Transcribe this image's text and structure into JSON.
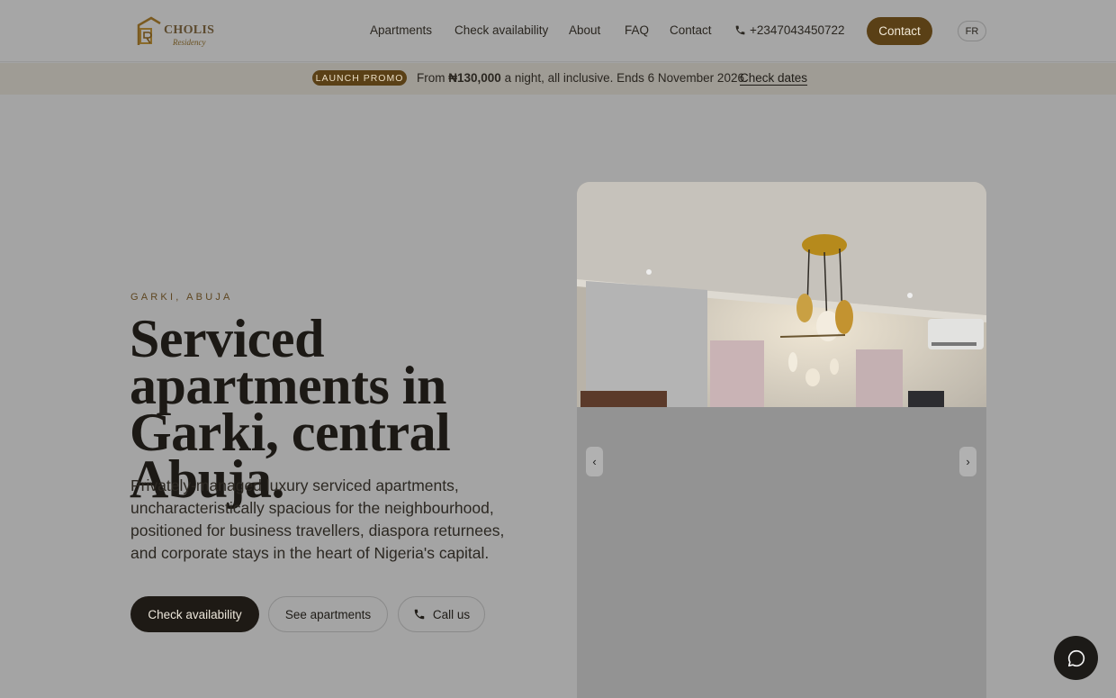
{
  "brand": {
    "name": "CHOLIS",
    "sub": "Residency",
    "monogram": "CR"
  },
  "nav": {
    "items": [
      "Apartments",
      "Check availability",
      "About",
      "FAQ",
      "Contact"
    ],
    "phone": "+2347043450722",
    "contact_button": "Contact",
    "lang_button": "FR"
  },
  "promo": {
    "badge": "LAUNCH PROMO",
    "text_prefix": "From ",
    "price": "₦130,000",
    "text_suffix": " a night, all inclusive. Ends 6 November 2026.",
    "link": "Check dates"
  },
  "hero": {
    "eyebrow": "GARKI, ABUJA",
    "headline": "Serviced apartments in Garki, central Abuja.",
    "lede": "Privately-managed luxury serviced apartments, uncharacteristically spacious for the neighbourhood, positioned for business travellers, diaspora returnees, and corporate stays in the heart of Nigeria's capital.",
    "buttons": {
      "primary": "Check availability",
      "secondary": "See apartments",
      "call": "Call us"
    }
  },
  "gallery": {
    "prev": "‹",
    "next": "›"
  },
  "icons": {
    "phone": "phone-icon",
    "chat": "chat-bubble-icon",
    "prev": "chevron-left-icon",
    "next": "chevron-right-icon"
  },
  "colors": {
    "accent": "#5a4016",
    "dark": "#1e1a15",
    "overlay_bg": "#a4a4a4"
  }
}
